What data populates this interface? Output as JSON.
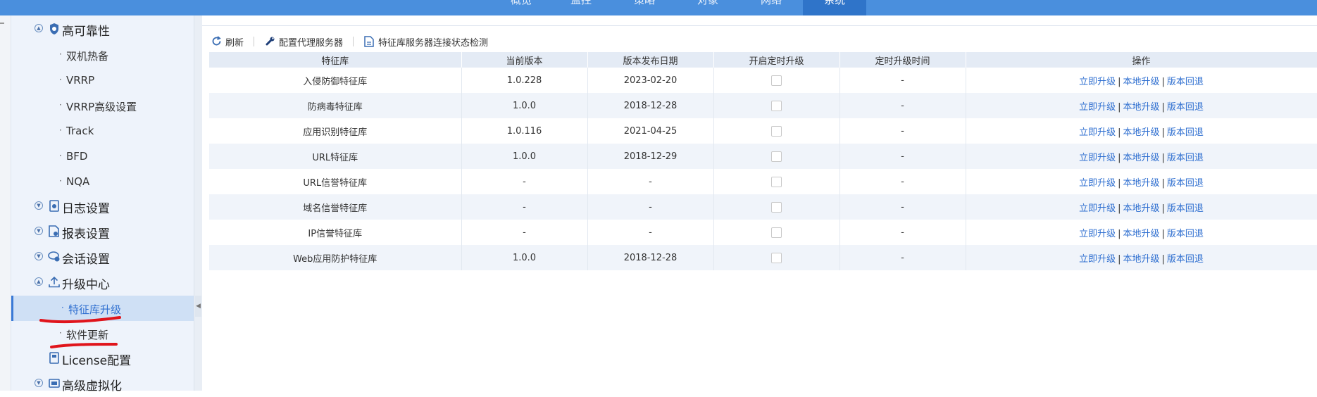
{
  "topnav": {
    "tabs": [
      {
        "label": "概览",
        "active": false
      },
      {
        "label": "监控",
        "active": false
      },
      {
        "label": "策略",
        "active": false
      },
      {
        "label": "对象",
        "active": false
      },
      {
        "label": "网络",
        "active": false
      },
      {
        "label": "系统",
        "active": true
      }
    ],
    "colors": {
      "bar": "#4a8fdd",
      "active": "#2f74c9"
    }
  },
  "sidebar": {
    "groups": [
      {
        "label": "高可靠性",
        "icon": "shield-icon",
        "items": [
          "双机热备",
          "VRRP",
          "VRRP高级设置",
          "Track",
          "BFD",
          "NQA"
        ]
      },
      {
        "label": "日志设置",
        "icon": "log-icon"
      },
      {
        "label": "报表设置",
        "icon": "report-icon"
      },
      {
        "label": "会话设置",
        "icon": "session-icon"
      },
      {
        "label": "升级中心",
        "icon": "upload-icon",
        "items": [
          "特征库升级",
          "软件更新"
        ],
        "active_item": "特征库升级"
      },
      {
        "label": "License配置",
        "icon": "license-icon"
      },
      {
        "label": "高级虚拟化",
        "icon": "virtualization-icon"
      }
    ]
  },
  "toolbar": {
    "refresh": "刷新",
    "proxy": "配置代理服务器",
    "check": "特征库服务器连接状态检测"
  },
  "table": {
    "columns": [
      "特征库",
      "当前版本",
      "版本发布日期",
      "开启定时升级",
      "定时升级时间",
      "操作"
    ],
    "rows": [
      {
        "name": "入侵防御特征库",
        "version": "1.0.228",
        "date": "2023-02-20",
        "scheduled": false,
        "time": "-"
      },
      {
        "name": "防病毒特征库",
        "version": "1.0.0",
        "date": "2018-12-28",
        "scheduled": false,
        "time": "-"
      },
      {
        "name": "应用识别特征库",
        "version": "1.0.116",
        "date": "2021-04-25",
        "scheduled": false,
        "time": "-"
      },
      {
        "name": "URL特征库",
        "version": "1.0.0",
        "date": "2018-12-29",
        "scheduled": false,
        "time": "-"
      },
      {
        "name": "URL信誉特征库",
        "version": "-",
        "date": "-",
        "scheduled": false,
        "time": "-"
      },
      {
        "name": "域名信誉特征库",
        "version": "-",
        "date": "-",
        "scheduled": false,
        "time": "-"
      },
      {
        "name": "IP信誉特征库",
        "version": "-",
        "date": "-",
        "scheduled": false,
        "time": "-"
      },
      {
        "name": "Web应用防护特征库",
        "version": "1.0.0",
        "date": "2018-12-28",
        "scheduled": false,
        "time": "-"
      }
    ],
    "actions": {
      "upgrade": "立即升级",
      "local": "本地升级",
      "rollback": "版本回退",
      "separator": "|"
    }
  },
  "accent": {
    "link": "#2f6fd0",
    "annotation": "#e0141b"
  }
}
